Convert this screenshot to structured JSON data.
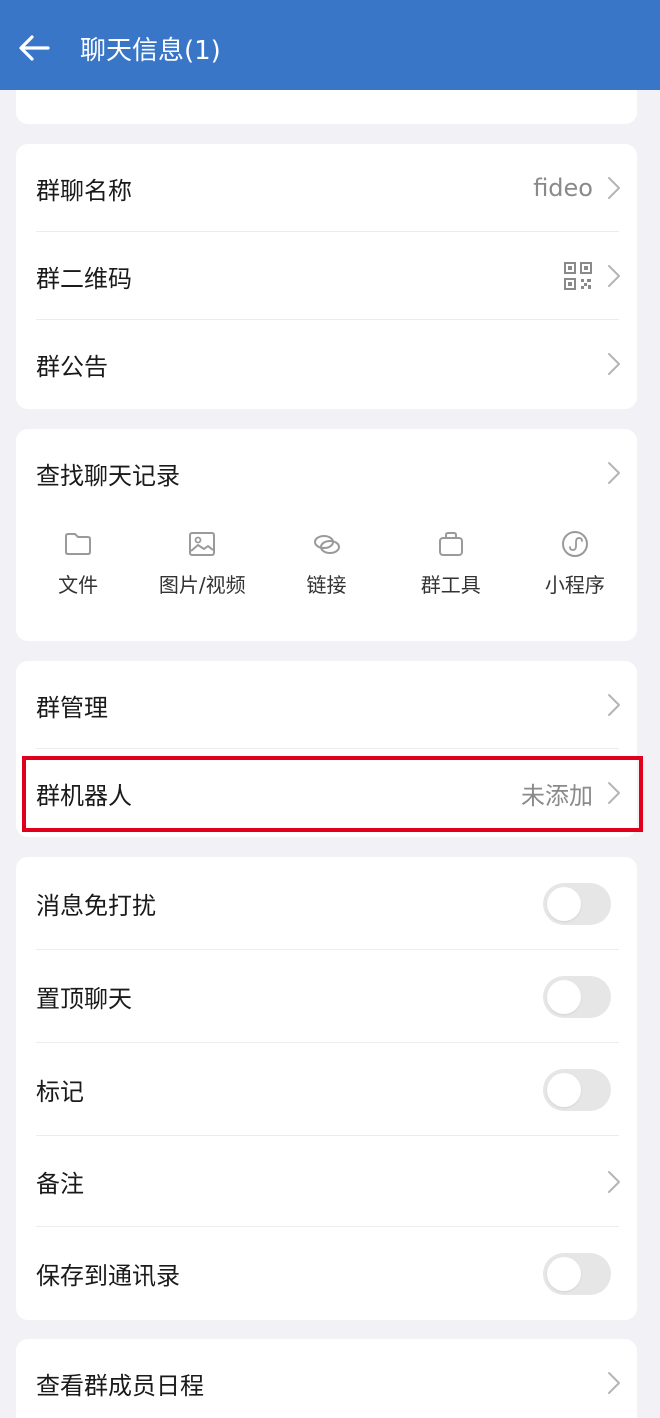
{
  "header": {
    "title": "聊天信息(1)"
  },
  "group_info": {
    "name_label": "群聊名称",
    "name_value": "fideo",
    "qr_label": "群二维码",
    "notice_label": "群公告"
  },
  "history": {
    "search_label": "查找聊天记录",
    "categories": [
      {
        "label": "文件",
        "icon": "folder-icon"
      },
      {
        "label": "图片/视频",
        "icon": "image-icon"
      },
      {
        "label": "链接",
        "icon": "link-icon"
      },
      {
        "label": "群工具",
        "icon": "briefcase-icon"
      },
      {
        "label": "小程序",
        "icon": "mini-program-icon"
      }
    ]
  },
  "manage": {
    "manage_label": "群管理",
    "robot_label": "群机器人",
    "robot_value": "未添加"
  },
  "settings": {
    "mute_label": "消息免打扰",
    "pin_label": "置顶聊天",
    "mark_label": "标记",
    "remark_label": "备注",
    "save_label": "保存到通讯录"
  },
  "schedule": {
    "label": "查看群成员日程"
  },
  "colors": {
    "header": "#3a76c8",
    "highlight": "#e0001b",
    "background": "#f2f2f6"
  }
}
